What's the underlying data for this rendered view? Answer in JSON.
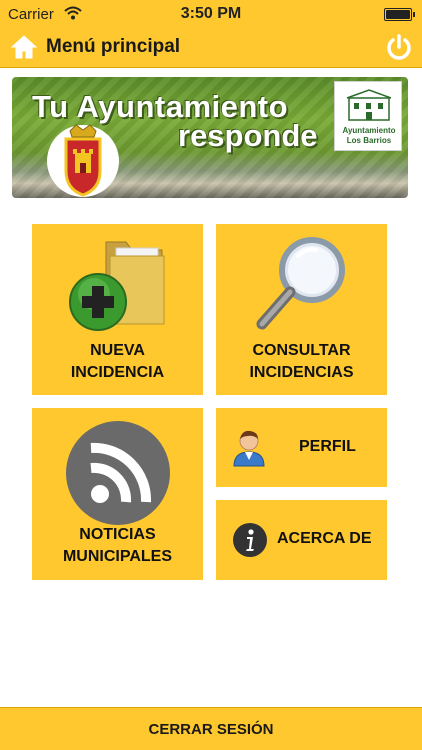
{
  "status_bar": {
    "carrier": "Carrier",
    "time": "3:50 PM",
    "wifi_icon": "wifi-icon",
    "battery_icon": "battery-icon"
  },
  "nav": {
    "title": "Menú principal",
    "home_icon": "home-icon",
    "power_icon": "power-icon"
  },
  "banner": {
    "title_line1": "Tu Ayuntamiento",
    "title_line2": "responde",
    "logo_line1": "Ayuntamiento",
    "logo_line2": "Los Barrios"
  },
  "tiles": {
    "nueva": {
      "line1": "NUEVA",
      "line2": "INCIDENCIA",
      "icon": "folder-add-icon"
    },
    "consultar": {
      "line1": "CONSULTAR",
      "line2": "INCIDENCIAS",
      "icon": "magnifier-icon"
    },
    "noticias": {
      "line1": "NOTICIAS",
      "line2": "MUNICIPALES",
      "icon": "rss-icon"
    },
    "perfil": {
      "label": "PERFIL",
      "icon": "person-icon"
    },
    "acerca": {
      "label": "ACERCA DE",
      "icon": "info-icon"
    }
  },
  "footer": {
    "label": "CERRAR SESIÓN"
  },
  "colors": {
    "accent": "#FFC82E",
    "background": "#FFFFFF",
    "text": "#111111"
  }
}
